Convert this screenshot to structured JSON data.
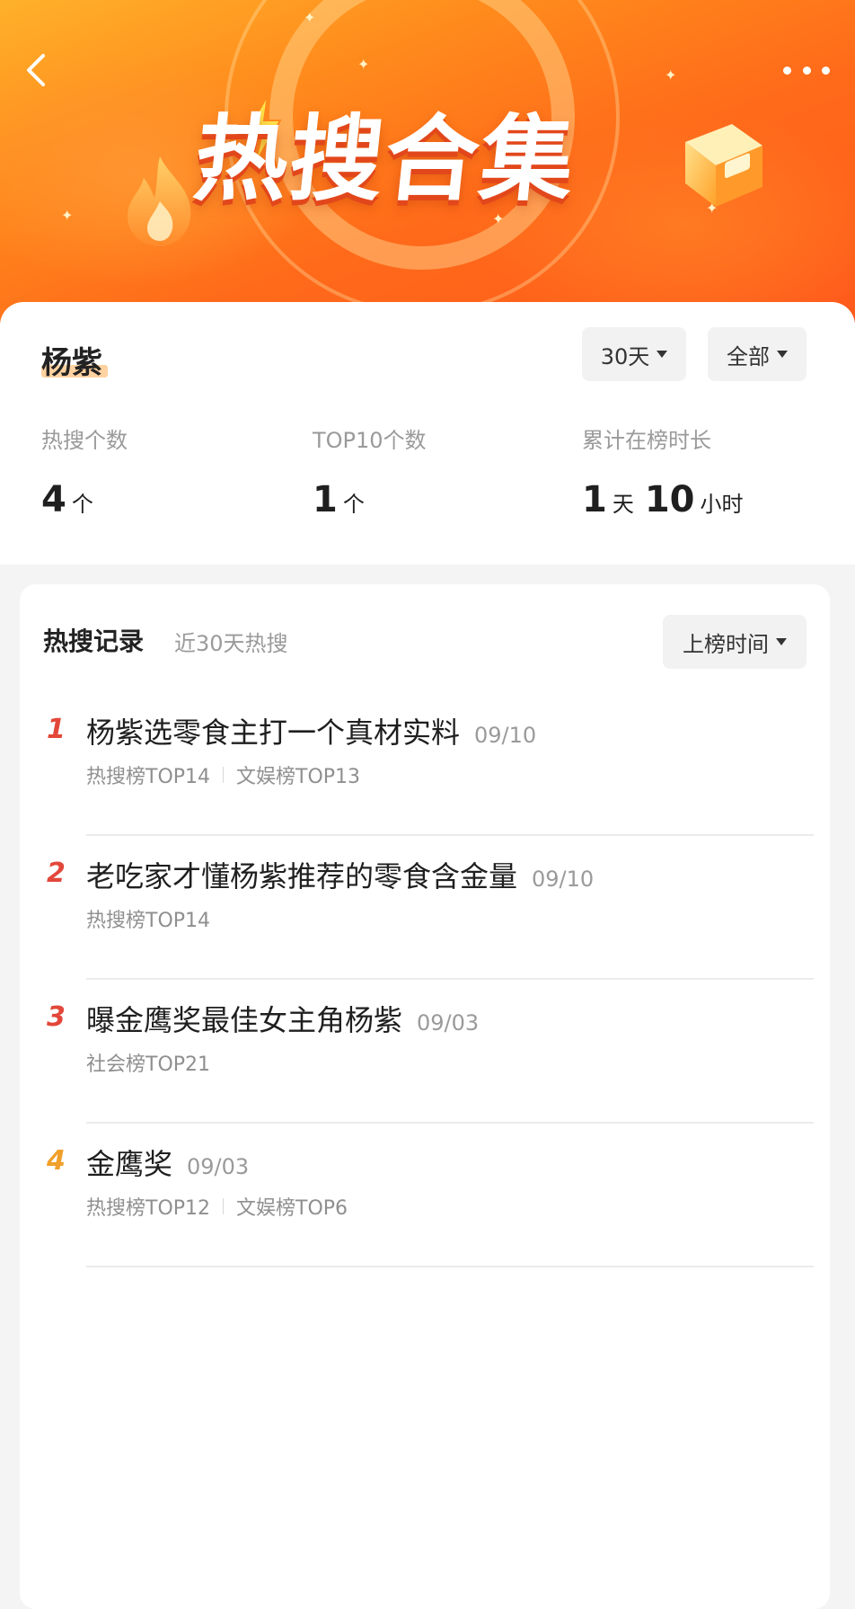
{
  "banner": {
    "title": "热搜合集"
  },
  "header": {
    "back_icon": "chevron-left-icon",
    "more_icon": "more-horizontal-icon"
  },
  "person": {
    "name": "杨紫"
  },
  "filters": {
    "days": "30天",
    "scope": "全部"
  },
  "stats": {
    "hot_count_label": "热搜个数",
    "hot_count_value": "4",
    "hot_count_unit": "个",
    "top10_label": "TOP10个数",
    "top10_value": "1",
    "top10_unit": "个",
    "duration_label": "累计在榜时长",
    "duration_days": "1",
    "duration_days_unit": "天",
    "duration_hours": "10",
    "duration_hours_unit": "小时"
  },
  "records": {
    "title": "热搜记录",
    "subtitle": "近30天热搜",
    "sort_label": "上榜时间",
    "items": [
      {
        "rank": "1",
        "title": "杨紫选零食主打一个真材实料",
        "date": "09/10",
        "tags": [
          "热搜榜TOP14",
          "文娱榜TOP13"
        ]
      },
      {
        "rank": "2",
        "title": "老吃家才懂杨紫推荐的零食含金量",
        "date": "09/10",
        "tags": [
          "热搜榜TOP14"
        ]
      },
      {
        "rank": "3",
        "title": "曝金鹰奖最佳女主角杨紫",
        "date": "09/03",
        "tags": [
          "社会榜TOP21"
        ]
      },
      {
        "rank": "4",
        "title": "金鹰奖",
        "date": "09/03",
        "tags": [
          "热搜榜TOP12",
          "文娱榜TOP6"
        ]
      }
    ]
  },
  "colors": {
    "banner_orange": "#ff6a1a",
    "rank_red": "#e2473a",
    "rank_gold": "#f0a02a",
    "name_highlight": "#ffd2a1"
  }
}
